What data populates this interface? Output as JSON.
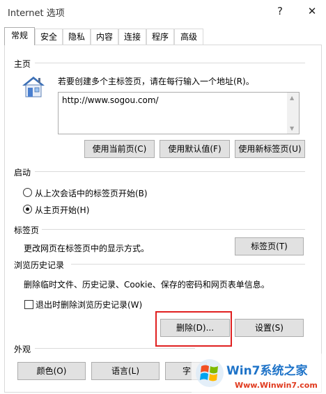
{
  "window": {
    "title": "Internet 选项",
    "help": "?",
    "close": "✕"
  },
  "tabs": [
    "常规",
    "安全",
    "隐私",
    "内容",
    "连接",
    "程序",
    "高级"
  ],
  "home": {
    "section": "主页",
    "hint": "若要创建多个主标签页，请在每行输入一个地址(R)。",
    "value": "http://www.sogou.com/",
    "btn_current": "使用当前页(C)",
    "btn_default": "使用默认值(F)",
    "btn_newtab": "使用新标签页(U)"
  },
  "startup": {
    "section": "启动",
    "option1": "从上次会话中的标签页开始(B)",
    "option2": "从主页开始(H)",
    "selected": 2
  },
  "tabsec": {
    "section": "标签页",
    "desc": "更改网页在标签页中的显示方式。",
    "btn": "标签页(T)"
  },
  "history": {
    "section": "浏览历史记录",
    "desc": "删除临时文件、历史记录、Cookie、保存的密码和网页表单信息。",
    "checkbox": "退出时删除浏览历史记录(W)",
    "btn_delete": "删除(D)...",
    "btn_settings": "设置(S)"
  },
  "appearance": {
    "section": "外观",
    "btn_colors": "颜色(O)",
    "btn_lang": "语言(L)",
    "btn_font_partial": "字"
  },
  "watermark": {
    "line1": "Win7系统之家",
    "line2": "Www.Winwin7.com"
  }
}
